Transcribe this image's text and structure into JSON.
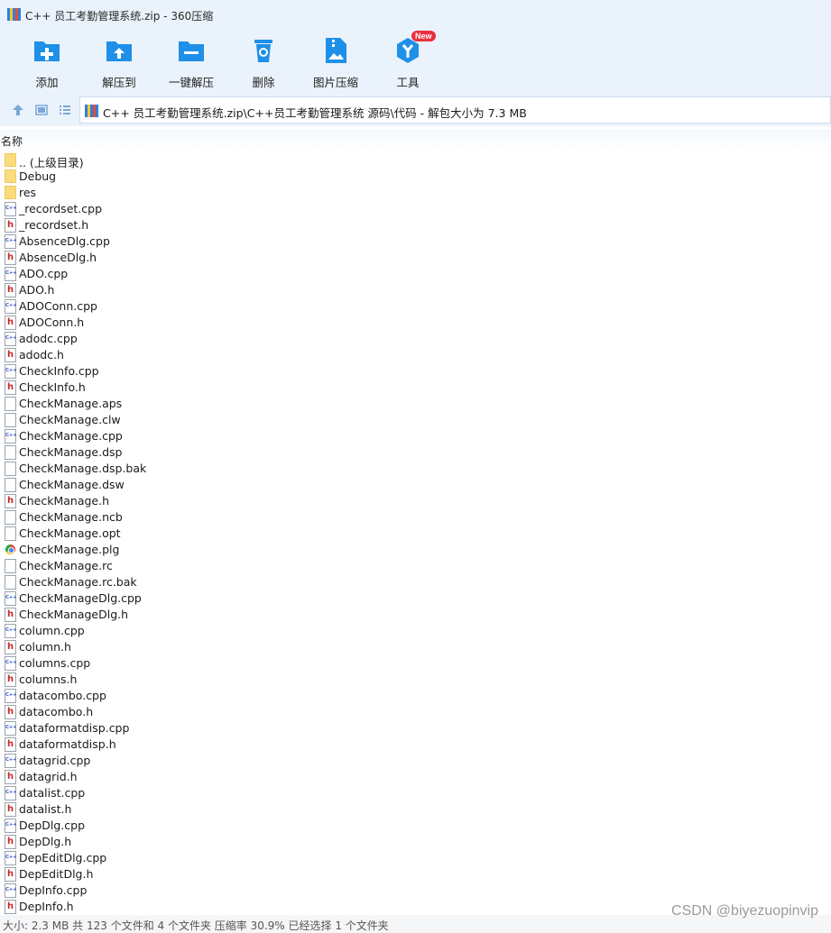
{
  "window": {
    "title": "C++ 员工考勤管理系统.zip - 360压缩"
  },
  "toolbar": {
    "add": "添加",
    "extract_to": "解压到",
    "one_click_extract": "一键解压",
    "delete": "删除",
    "image_compress": "图片压缩",
    "tools": "工具",
    "tools_badge": "New"
  },
  "address": {
    "path": "C++ 员工考勤管理系统.zip\\C++员工考勤管理系统 源码\\代码 - 解包大小为 7.3 MB"
  },
  "list": {
    "column_name": "名称",
    "files": [
      {
        "name": ".. (上级目录)",
        "icon": "folder"
      },
      {
        "name": "Debug",
        "icon": "folder"
      },
      {
        "name": "res",
        "icon": "folder"
      },
      {
        "name": "_recordset.cpp",
        "icon": "cpp"
      },
      {
        "name": "_recordset.h",
        "icon": "h"
      },
      {
        "name": "AbsenceDlg.cpp",
        "icon": "cpp"
      },
      {
        "name": "AbsenceDlg.h",
        "icon": "h"
      },
      {
        "name": "ADO.cpp",
        "icon": "cpp"
      },
      {
        "name": "ADO.h",
        "icon": "h"
      },
      {
        "name": "ADOConn.cpp",
        "icon": "cpp"
      },
      {
        "name": "ADOConn.h",
        "icon": "h"
      },
      {
        "name": "adodc.cpp",
        "icon": "cpp"
      },
      {
        "name": "adodc.h",
        "icon": "h"
      },
      {
        "name": "CheckInfo.cpp",
        "icon": "cpp"
      },
      {
        "name": "CheckInfo.h",
        "icon": "h"
      },
      {
        "name": "CheckManage.aps",
        "icon": "doc"
      },
      {
        "name": "CheckManage.clw",
        "icon": "doc"
      },
      {
        "name": "CheckManage.cpp",
        "icon": "cpp"
      },
      {
        "name": "CheckManage.dsp",
        "icon": "doc"
      },
      {
        "name": "CheckManage.dsp.bak",
        "icon": "doc"
      },
      {
        "name": "CheckManage.dsw",
        "icon": "doc"
      },
      {
        "name": "CheckManage.h",
        "icon": "h"
      },
      {
        "name": "CheckManage.ncb",
        "icon": "doc"
      },
      {
        "name": "CheckManage.opt",
        "icon": "doc"
      },
      {
        "name": "CheckManage.plg",
        "icon": "plg"
      },
      {
        "name": "CheckManage.rc",
        "icon": "doc"
      },
      {
        "name": "CheckManage.rc.bak",
        "icon": "doc"
      },
      {
        "name": "CheckManageDlg.cpp",
        "icon": "cpp"
      },
      {
        "name": "CheckManageDlg.h",
        "icon": "h"
      },
      {
        "name": "column.cpp",
        "icon": "cpp"
      },
      {
        "name": "column.h",
        "icon": "h"
      },
      {
        "name": "columns.cpp",
        "icon": "cpp"
      },
      {
        "name": "columns.h",
        "icon": "h"
      },
      {
        "name": "datacombo.cpp",
        "icon": "cpp"
      },
      {
        "name": "datacombo.h",
        "icon": "h"
      },
      {
        "name": "dataformatdisp.cpp",
        "icon": "cpp"
      },
      {
        "name": "dataformatdisp.h",
        "icon": "h"
      },
      {
        "name": "datagrid.cpp",
        "icon": "cpp"
      },
      {
        "name": "datagrid.h",
        "icon": "h"
      },
      {
        "name": "datalist.cpp",
        "icon": "cpp"
      },
      {
        "name": "datalist.h",
        "icon": "h"
      },
      {
        "name": "DepDlg.cpp",
        "icon": "cpp"
      },
      {
        "name": "DepDlg.h",
        "icon": "h"
      },
      {
        "name": "DepEditDlg.cpp",
        "icon": "cpp"
      },
      {
        "name": "DepEditDlg.h",
        "icon": "h"
      },
      {
        "name": "DepInfo.cpp",
        "icon": "cpp"
      },
      {
        "name": "DepInfo.h",
        "icon": "h"
      }
    ]
  },
  "status": {
    "text": "大小: 2.3 MB 共 123 个文件和 4 个文件夹 压缩率 30.9% 已经选择 1 个文件夹"
  },
  "watermark": "CSDN @biyezuopinvip",
  "colors": {
    "chrome": "#eaf2fb",
    "tool_blue": "#1e90e8",
    "folder": "#fbdc7d",
    "badge": "#ea2f3c"
  }
}
